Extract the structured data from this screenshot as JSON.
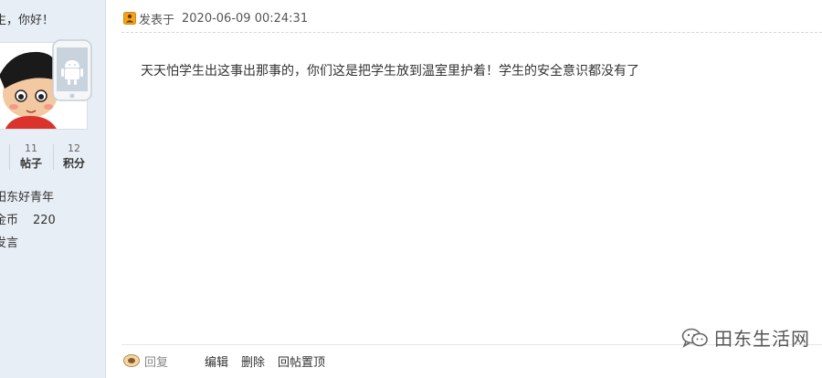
{
  "sidebar": {
    "greeting": "生，你好！",
    "stats": [
      {
        "num": "11",
        "label": "帖子"
      },
      {
        "num": "12",
        "label": "积分"
      }
    ],
    "user_title": "田东好青年",
    "coin_label": "金币",
    "coin_value": "220",
    "send_message": "发言"
  },
  "post": {
    "header_label": "发表于",
    "time": "2020-06-09 00:24:31",
    "content": "天天怕学生出这事出那事的，你们这是把学生放到温室里护着！学生的安全意识都没有了"
  },
  "actions": {
    "reply": "回复",
    "edit": "编辑",
    "delete": "删除",
    "top": "回帖置顶"
  },
  "watermark": {
    "text": "田东生活网"
  },
  "colors": {
    "sidebar_bg": "#e8eef6",
    "text": "#333333",
    "muted": "#888888"
  }
}
